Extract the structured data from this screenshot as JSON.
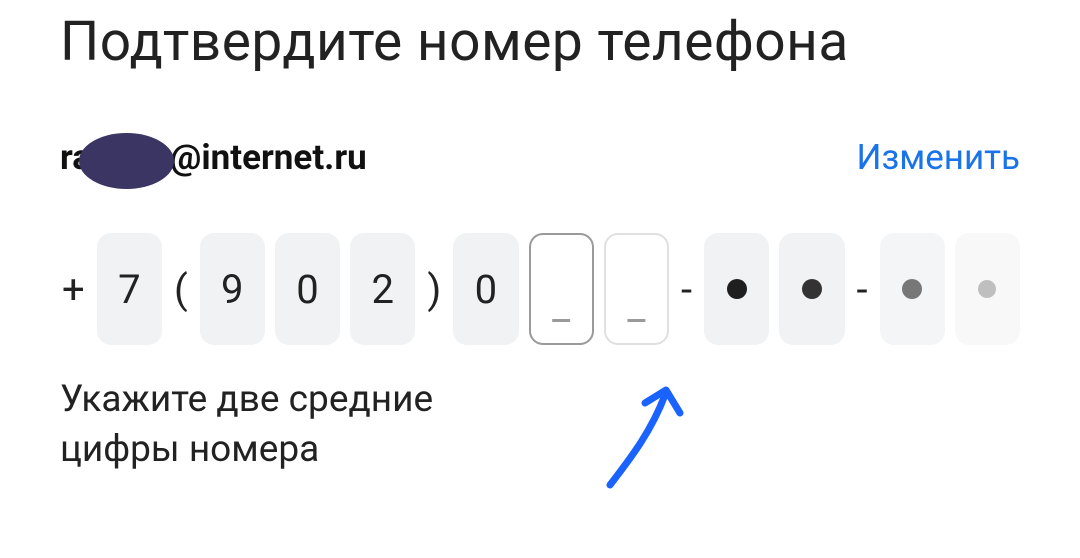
{
  "title": "Подтвердите номер телефона",
  "email": {
    "prefix": "ra",
    "suffix": "@internet.ru"
  },
  "change_link": "Изменить",
  "phone": {
    "plus": "+",
    "country": "7",
    "open_paren": "(",
    "d1": "9",
    "d2": "0",
    "d3": "2",
    "close_paren": ")",
    "d4": "0",
    "input1": "_",
    "input2": "_",
    "dash1": "-",
    "dash2": "-"
  },
  "hint": "Укажите две средние цифры номера"
}
